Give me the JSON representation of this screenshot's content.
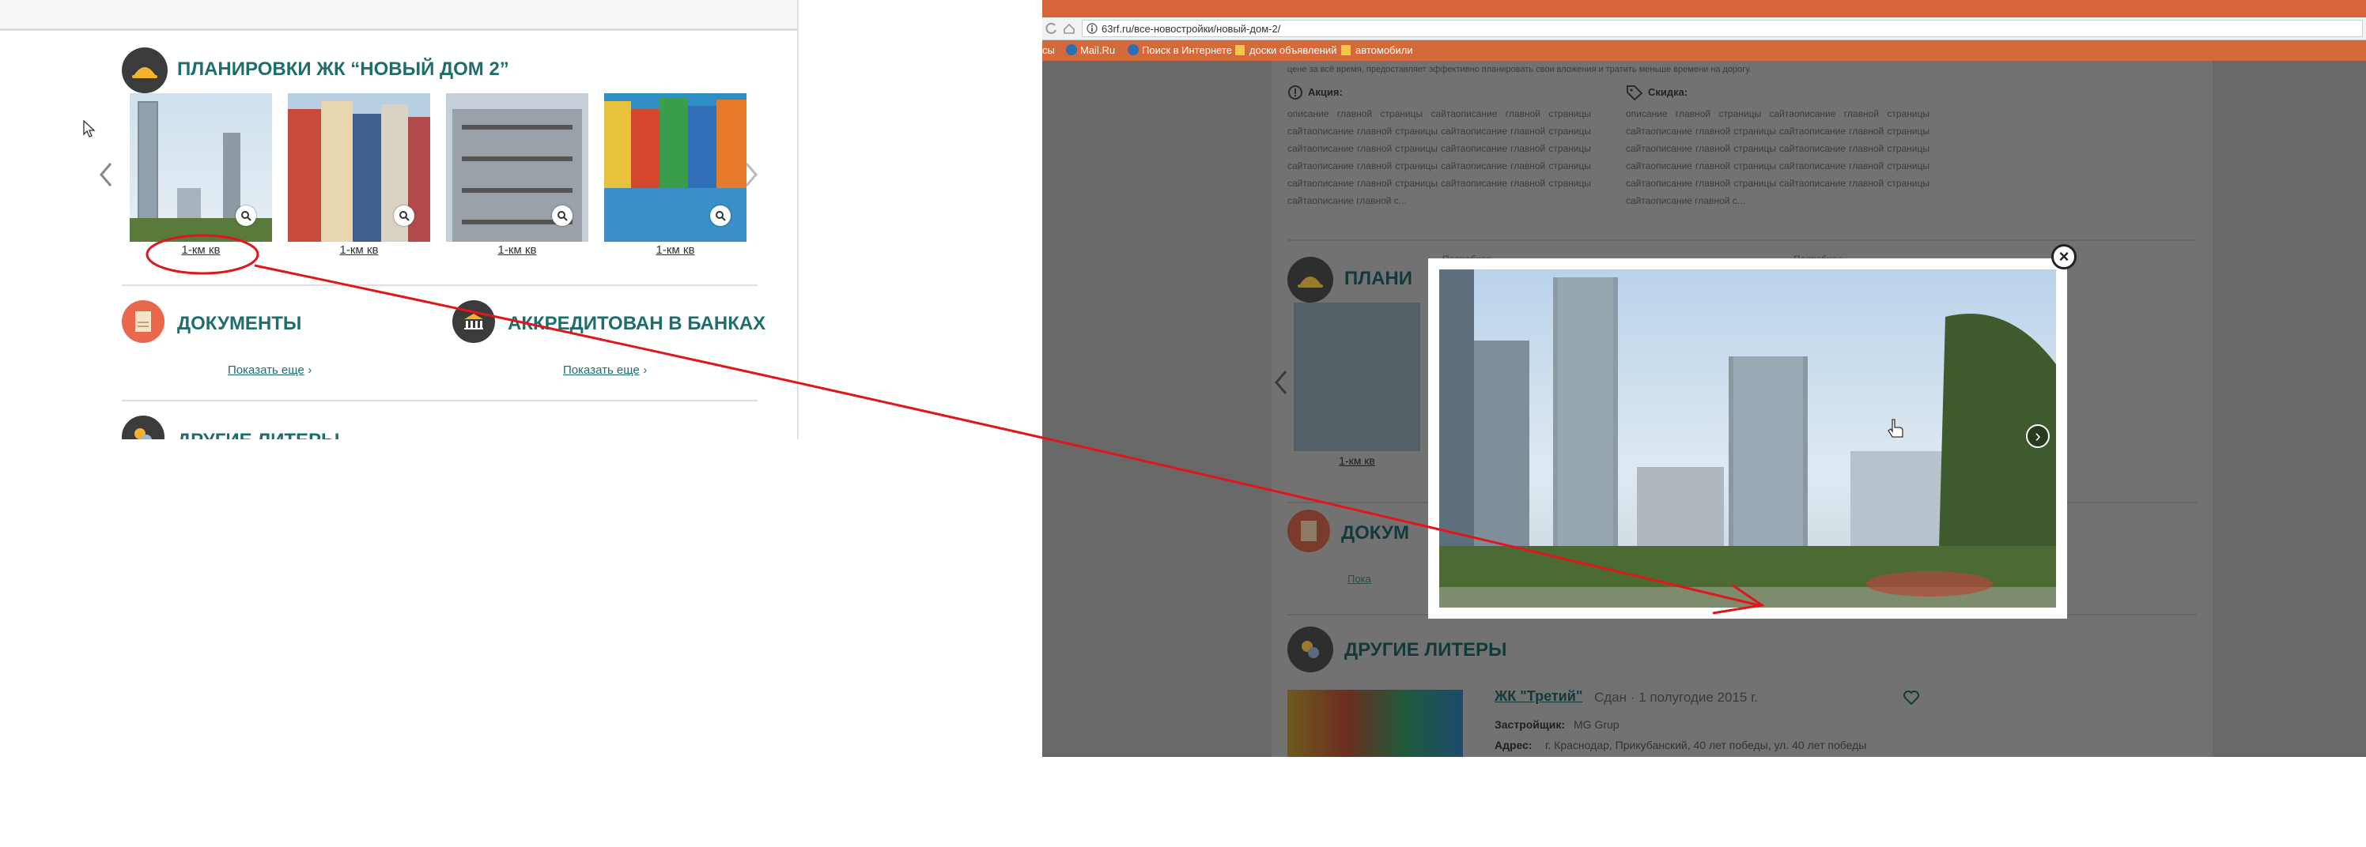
{
  "left": {
    "plans_title": "ПЛАНИРОВКИ ЖК “НОВЫЙ ДОМ 2”",
    "thumbs": [
      {
        "caption": "1-км кв"
      },
      {
        "caption": "1-км кв"
      },
      {
        "caption": "1-км кв"
      },
      {
        "caption": "1-км кв"
      }
    ],
    "documents_title": "ДОКУМЕНТЫ",
    "banks_title": "АККРЕДИТОВАН В БАНКАХ",
    "show_more": "Показать еще",
    "show_more_arrow": "›",
    "other_title": "ДРУГИЕ ЛИТЕРЫ"
  },
  "right": {
    "url": "63rf.ru/все-новостройки/новый-дом-2/",
    "bookmarks": [
      "сы",
      "Mail.Ru",
      "Поиск в Интернете",
      "доски объявлений",
      "автомобили"
    ],
    "intro_text": "цене за всё время, предоставляет эффективно планировать свои вложения и тратить меньше времени на дорогу.",
    "promo": {
      "label": "Акция:",
      "text": "описание главной страницы сайтаописание главной страницы сайтаописание главной страницы сайтаописание главной страницы сайтаописание главной страницы сайтаописание главной страницы сайтаописание главной страницы сайтаописание главной страницы сайтаописание главной страницы сайтаописание главной страницы сайтаописание главной с...",
      "more": "Подробнее"
    },
    "discount": {
      "label": "Скидка:",
      "text": "описание главной страницы сайтаописание главной страницы сайтаописание главной страницы сайтаописание главной страницы сайтаописание главной страницы сайтаописание главной страницы сайтаописание главной страницы сайтаописание главной страницы сайтаописание главной страницы сайтаописание главной страницы сайтаописание главной с...",
      "more": "Подробнее"
    },
    "plans_title_partial": "ПЛАНИ",
    "thumb_caption": "1-км кв",
    "documents_partial": "ДОКУМ",
    "show_more_partial": "Пока",
    "other_title": "ДРУГИЕ ЛИТЕРЫ",
    "listing": {
      "name": "ЖК \"Третий\"",
      "status": "Сдан · 1 полугодие 2015 г.",
      "developer_label": "Застройщик:",
      "developer": "MG Grup",
      "address_label": "Адрес:",
      "address": "г. Краснодар, Прикубанский, 40 лет победы, ул. 40 лет победы"
    },
    "close_label": "×",
    "next_label": "›"
  },
  "colors": {
    "teal": "#1f6d6c",
    "annotation_red": "#e0161b",
    "browser_orange": "#d46a3a"
  }
}
